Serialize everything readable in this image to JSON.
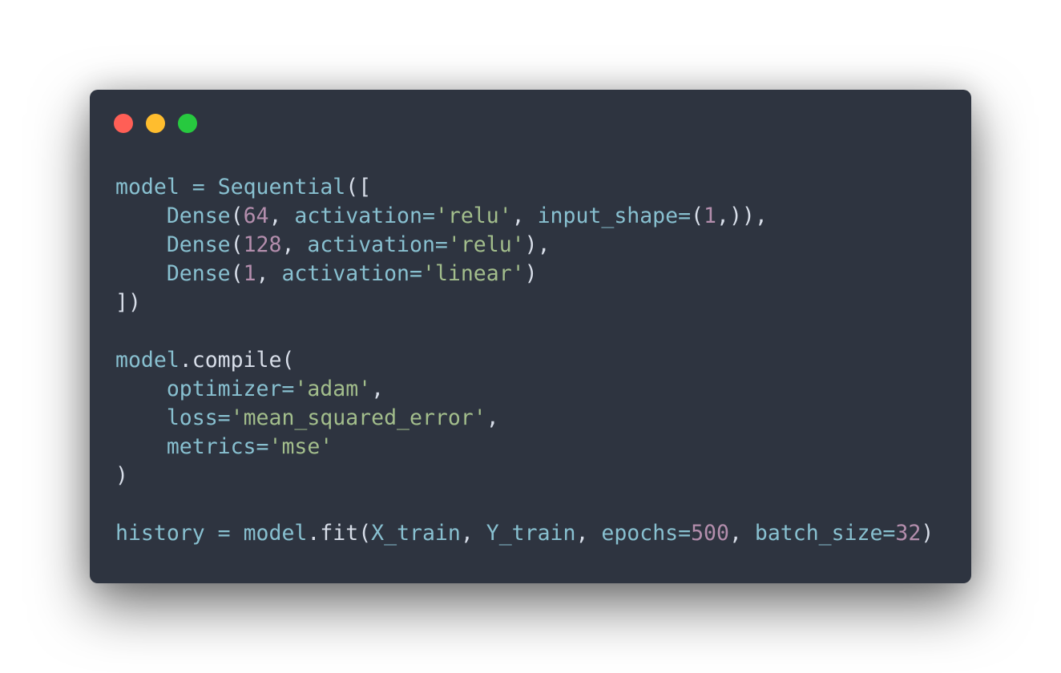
{
  "window": {
    "background": "#2e3440",
    "controls": [
      {
        "name": "close-control",
        "color": "#ff5f56"
      },
      {
        "name": "minimize-control",
        "color": "#ffbd2e"
      },
      {
        "name": "maximize-control",
        "color": "#27c93f"
      }
    ]
  },
  "palette": {
    "v": "#88c0d0",
    "p": "#d8dee9",
    "s": "#a3be8c",
    "n": "#b48ead"
  },
  "code_lines": [
    [
      [
        "v",
        "model"
      ],
      [
        "p",
        " "
      ],
      [
        "v",
        "="
      ],
      [
        "p",
        " "
      ],
      [
        "v",
        "Sequential"
      ],
      [
        "p",
        "(["
      ]
    ],
    [
      [
        "p",
        "    "
      ],
      [
        "v",
        "Dense"
      ],
      [
        "p",
        "("
      ],
      [
        "n",
        "64"
      ],
      [
        "p",
        ", "
      ],
      [
        "v",
        "activation"
      ],
      [
        "v",
        "="
      ],
      [
        "s",
        "'relu'"
      ],
      [
        "p",
        ", "
      ],
      [
        "v",
        "input_shape"
      ],
      [
        "v",
        "="
      ],
      [
        "p",
        "("
      ],
      [
        "n",
        "1"
      ],
      [
        "p",
        ",)),"
      ]
    ],
    [
      [
        "p",
        "    "
      ],
      [
        "v",
        "Dense"
      ],
      [
        "p",
        "("
      ],
      [
        "n",
        "128"
      ],
      [
        "p",
        ", "
      ],
      [
        "v",
        "activation"
      ],
      [
        "v",
        "="
      ],
      [
        "s",
        "'relu'"
      ],
      [
        "p",
        "),"
      ]
    ],
    [
      [
        "p",
        "    "
      ],
      [
        "v",
        "Dense"
      ],
      [
        "p",
        "("
      ],
      [
        "n",
        "1"
      ],
      [
        "p",
        ", "
      ],
      [
        "v",
        "activation"
      ],
      [
        "v",
        "="
      ],
      [
        "s",
        "'linear'"
      ],
      [
        "p",
        ")"
      ]
    ],
    [
      [
        "p",
        "])"
      ]
    ],
    [],
    [
      [
        "v",
        "model"
      ],
      [
        "p",
        ".compile("
      ]
    ],
    [
      [
        "p",
        "    "
      ],
      [
        "v",
        "optimizer"
      ],
      [
        "v",
        "="
      ],
      [
        "s",
        "'adam'"
      ],
      [
        "p",
        ","
      ]
    ],
    [
      [
        "p",
        "    "
      ],
      [
        "v",
        "loss"
      ],
      [
        "v",
        "="
      ],
      [
        "s",
        "'mean_squared_error'"
      ],
      [
        "p",
        ","
      ]
    ],
    [
      [
        "p",
        "    "
      ],
      [
        "v",
        "metrics"
      ],
      [
        "v",
        "="
      ],
      [
        "s",
        "'mse'"
      ]
    ],
    [
      [
        "p",
        ")"
      ]
    ],
    [],
    [
      [
        "v",
        "history"
      ],
      [
        "p",
        " "
      ],
      [
        "v",
        "="
      ],
      [
        "p",
        " "
      ],
      [
        "v",
        "model"
      ],
      [
        "p",
        ".fit("
      ],
      [
        "v",
        "X_train"
      ],
      [
        "p",
        ", "
      ],
      [
        "v",
        "Y_train"
      ],
      [
        "p",
        ", "
      ],
      [
        "v",
        "epochs"
      ],
      [
        "v",
        "="
      ],
      [
        "n",
        "500"
      ],
      [
        "p",
        ", "
      ],
      [
        "v",
        "batch_size"
      ],
      [
        "v",
        "="
      ],
      [
        "n",
        "32"
      ],
      [
        "p",
        ")"
      ]
    ]
  ]
}
